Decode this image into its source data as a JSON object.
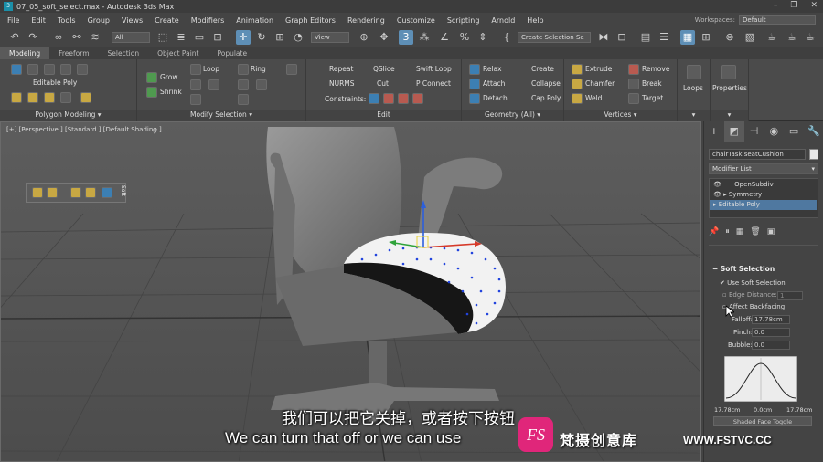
{
  "window": {
    "title": "07_05_soft_select.max - Autodesk 3ds Max",
    "app_icon": "3"
  },
  "menu": [
    "File",
    "Edit",
    "Tools",
    "Group",
    "Views",
    "Create",
    "Modifiers",
    "Animation",
    "Graph Editors",
    "Rendering",
    "Customize",
    "Scripting",
    "Arnold",
    "Help"
  ],
  "workspaces": {
    "label": "Workspaces:",
    "value": "Default"
  },
  "toolbar": {
    "filter_value": "All",
    "view_value": "View",
    "selection_set": "Create Selection Se"
  },
  "ribbon_tabs": [
    "Modeling",
    "Freeform",
    "Selection",
    "Object Paint",
    "Populate"
  ],
  "ribbon": {
    "polygon_modeling": {
      "mode_label": "Editable Poly",
      "footer": "Polygon Modeling"
    },
    "modify_selection": {
      "grow": "Grow",
      "shrink": "Shrink",
      "loop": "Loop",
      "ring": "Ring",
      "footer": "Modify Selection"
    },
    "edit": {
      "repeat": "Repeat",
      "qslice": "QSlice",
      "swift_loop": "Swift Loop",
      "nurms": "NURMS",
      "cut": "Cut",
      "p_connect": "P Connect",
      "constraints": "Constraints:",
      "footer": "Edit"
    },
    "geometry": {
      "relax": "Relax",
      "create": "Create",
      "attach": "Attach",
      "collapse": "Collapse",
      "detach": "Detach",
      "cap_poly": "Cap Poly",
      "footer": "Geometry (All)"
    },
    "vertices": {
      "extrude": "Extrude",
      "remove": "Remove",
      "chamfer": "Chamfer",
      "break": "Break",
      "weld": "Weld",
      "target": "Target",
      "footer": "Vertices"
    },
    "loops": "Loops",
    "properties": "Properties"
  },
  "viewport": {
    "label": "[+] [Perspective ] [Standard ] [Default Shading ]",
    "float_label": "Soft"
  },
  "command_panel": {
    "object_name": "chairTask seatCushion",
    "modifier_list": "Modifier List",
    "stack": [
      {
        "name": "OpenSubdiv",
        "selected": false
      },
      {
        "name": "Symmetry",
        "selected": false
      },
      {
        "name": "Editable Poly",
        "selected": true
      }
    ],
    "soft_selection": {
      "header": "Soft Selection",
      "use_soft_selection": "Use Soft Selection",
      "edge_distance": "Edge Distance:",
      "edge_distance_value": "1",
      "affect_backfacing": "Affect Backfacing",
      "falloff": "Falloff:",
      "falloff_value": "17.78cm",
      "pinch": "Pinch:",
      "pinch_value": "0.0",
      "bubble": "Bubble:",
      "bubble_value": "0.0",
      "graph_left": "17.78cm",
      "graph_mid": "0.0cm",
      "graph_right": "17.78cm",
      "shaded_face_toggle": "Shaded Face Toggle"
    }
  },
  "subtitles": {
    "zh": "我们可以把它关掉，或者按下按钮",
    "en": "We can turn that off or we can use"
  },
  "watermark": {
    "logo": "FS",
    "brand": "梵摄创意库",
    "url": "WWW.FSTVC.CC"
  }
}
